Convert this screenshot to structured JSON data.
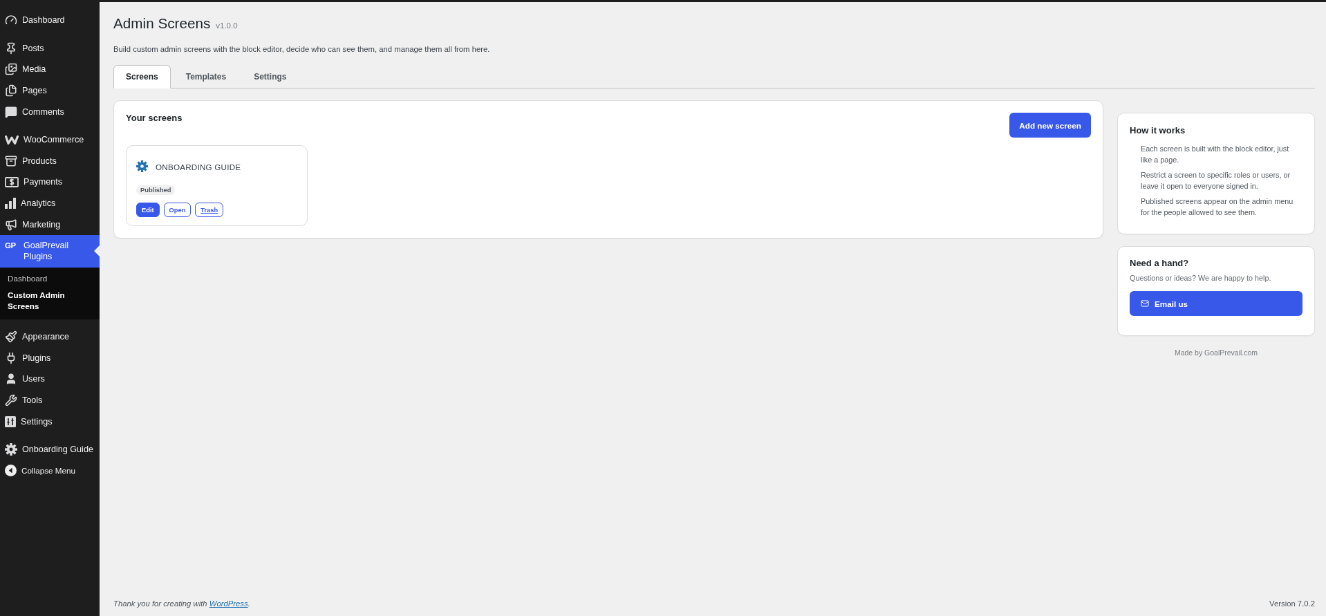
{
  "sidebar": {
    "groups": [
      {
        "items": [
          {
            "label": "Dashboard",
            "selected": false
          }
        ]
      },
      {
        "items": [
          {
            "label": "Posts",
            "selected": false
          },
          {
            "label": "Media",
            "selected": false
          },
          {
            "label": "Pages",
            "selected": false
          },
          {
            "label": "Comments",
            "selected": false
          }
        ]
      },
      {
        "items": [
          {
            "label": "WooCommerce",
            "selected": false
          },
          {
            "label": "Products",
            "selected": false
          },
          {
            "label": "Payments",
            "selected": false
          },
          {
            "label": "Analytics",
            "selected": false
          },
          {
            "label": "Marketing",
            "selected": false
          },
          {
            "label": "GoalPrevail Plugins",
            "icon_text": "GP",
            "selected": true,
            "children": [
              {
                "label": "Dashboard",
                "selected": false
              },
              {
                "label": "Custom Admin Screens",
                "selected": true
              }
            ]
          }
        ]
      },
      {
        "items": [
          {
            "label": "Appearance",
            "selected": false
          },
          {
            "label": "Plugins",
            "selected": false
          },
          {
            "label": "Users",
            "selected": false
          },
          {
            "label": "Tools",
            "selected": false
          },
          {
            "label": "Settings",
            "selected": false
          }
        ]
      },
      {
        "items": [
          {
            "label": "Onboarding Guide",
            "selected": false
          }
        ]
      }
    ],
    "collapse": "Collapse Menu"
  },
  "header": {
    "title": "Admin Screens",
    "version": "v1.0.0",
    "description": "Build custom admin screens with the block editor, decide who can see them, and manage them all from here."
  },
  "tabs": [
    {
      "label": "Screens",
      "selected": true
    },
    {
      "label": "Templates",
      "selected": false
    },
    {
      "label": "Settings",
      "selected": false
    }
  ],
  "screens_panel": {
    "title": "Your screens",
    "add_button": "Add new screen",
    "screens": [
      {
        "title": "ONBOARDING GUIDE",
        "status": "Published",
        "actions": [
          {
            "label": "Edit",
            "kind": "primary"
          },
          {
            "label": "Open",
            "kind": "outline"
          },
          {
            "label": "Trash",
            "kind": "underlined"
          }
        ]
      }
    ]
  },
  "how_it_works": {
    "title": "How it works",
    "items": [
      "Each screen is built with the block editor, just like a page.",
      "Restrict a screen to specific roles or users, or leave it open to everyone signed in.",
      "Published screens appear on the admin menu for the people allowed to see them."
    ]
  },
  "help": {
    "title": "Need a hand?",
    "text": "Questions or ideas? We are happy to help.",
    "button": "Email us"
  },
  "credit": "Made by GoalPrevail.com",
  "footer": {
    "thanks": "Thank you for creating with",
    "link": "WordPress",
    "end": ".",
    "version": "Version 7.0.2"
  }
}
